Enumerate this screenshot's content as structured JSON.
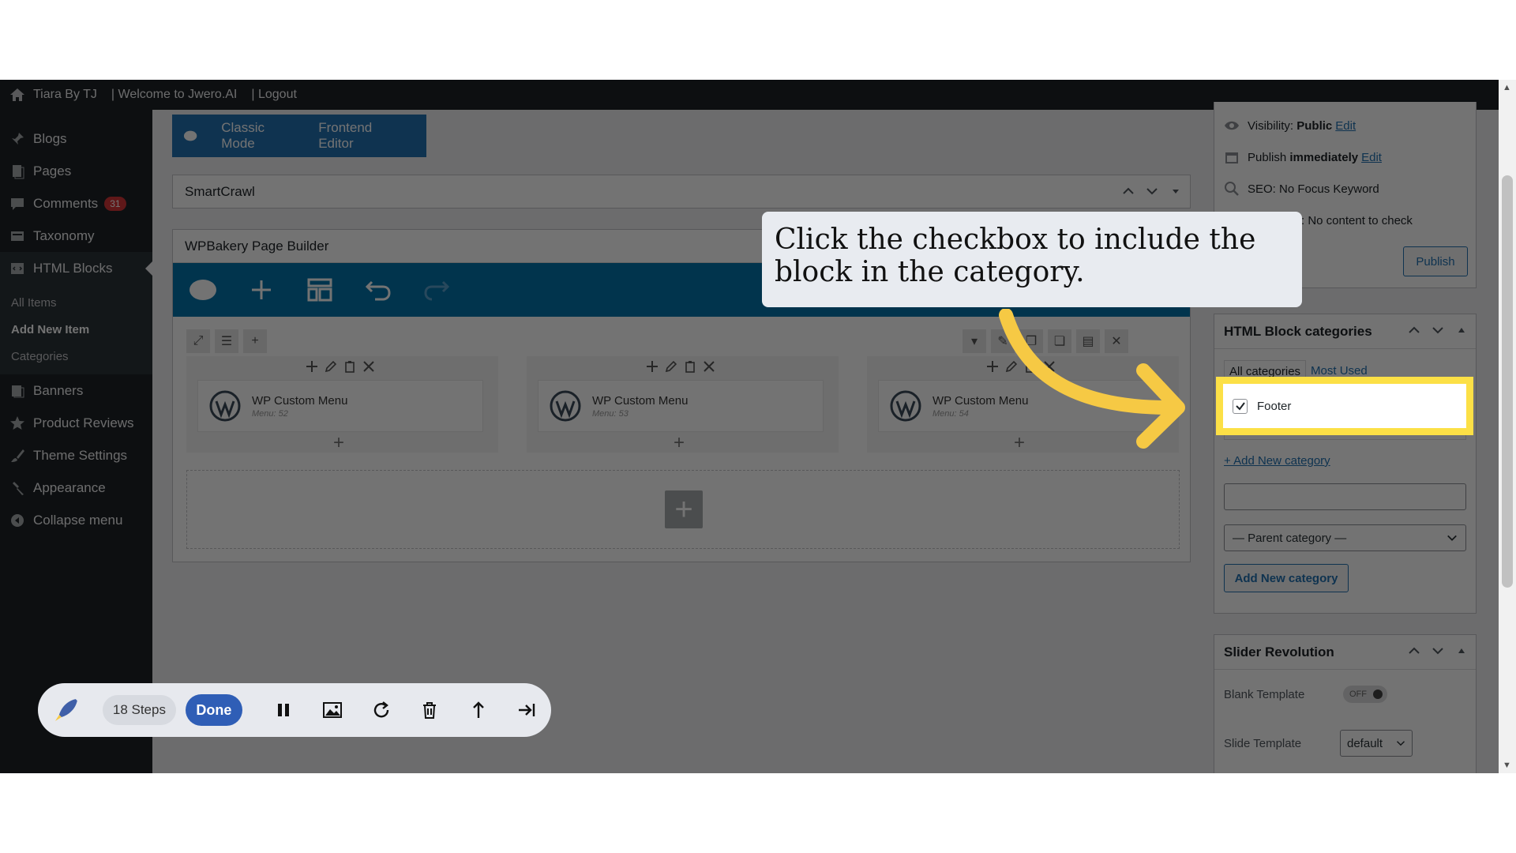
{
  "admin_bar": {
    "site_name": "Tiara By TJ",
    "welcome": "| Welcome to Jwero.AI",
    "logout": "| Logout"
  },
  "sidebar": {
    "items": [
      {
        "label": "Blogs",
        "icon": "pin-icon"
      },
      {
        "label": "Pages",
        "icon": "pages-icon"
      },
      {
        "label": "Comments",
        "icon": "comment-icon",
        "badge": "31"
      },
      {
        "label": "Taxonomy",
        "icon": "taxonomy-icon"
      },
      {
        "label": "HTML Blocks",
        "icon": "code-icon",
        "active": true
      }
    ],
    "submenu": [
      "All Items",
      "Add New Item",
      "Categories"
    ],
    "items_after": [
      {
        "label": "Banners",
        "icon": "banners-icon"
      },
      {
        "label": "Product Reviews",
        "icon": "star-icon"
      },
      {
        "label": "Theme Settings",
        "icon": "brush-icon"
      },
      {
        "label": "Appearance",
        "icon": "hammer-icon"
      },
      {
        "label": "Collapse menu",
        "icon": "collapse-icon"
      }
    ]
  },
  "editor": {
    "mode_bar": {
      "classic": "Classic Mode",
      "frontend": "Frontend Editor"
    },
    "smartcrawl_title": "SmartCrawl",
    "wpbakery_title": "WPBakery Page Builder",
    "elements": [
      {
        "title": "WP Custom Menu",
        "sub": "Menu: 52"
      },
      {
        "title": "WP Custom Menu",
        "sub": "Menu: 53"
      },
      {
        "title": "WP Custom Menu",
        "sub": "Menu: 54"
      }
    ]
  },
  "publish_box": {
    "visibility_label": "Visibility:",
    "visibility_value": "Public",
    "edit": "Edit",
    "publish_label": "Publish",
    "publish_value": "immediately",
    "seo_label": "SEO:",
    "seo_value": "No Focus Keyword",
    "readability_partial": ": No content to check",
    "publish_button": "Publish"
  },
  "categories_box": {
    "title": "HTML Block categories",
    "tab_all": "All categories",
    "tab_most_used": "Most Used",
    "category": "Footer",
    "add_new_link": "+ Add New category",
    "parent_placeholder": "— Parent category —",
    "add_button": "Add New category"
  },
  "slider_box": {
    "title": "Slider Revolution",
    "blank_label": "Blank Template",
    "blank_state": "OFF",
    "slide_label": "Slide Template",
    "slide_value": "default"
  },
  "callout": {
    "text": "Click the checkbox to include the block in the category."
  },
  "recorder": {
    "steps": "18 Steps",
    "done": "Done"
  },
  "colors": {
    "highlight": "#fce046",
    "wp_blue": "#2271b1",
    "arrow": "#f6c944"
  }
}
